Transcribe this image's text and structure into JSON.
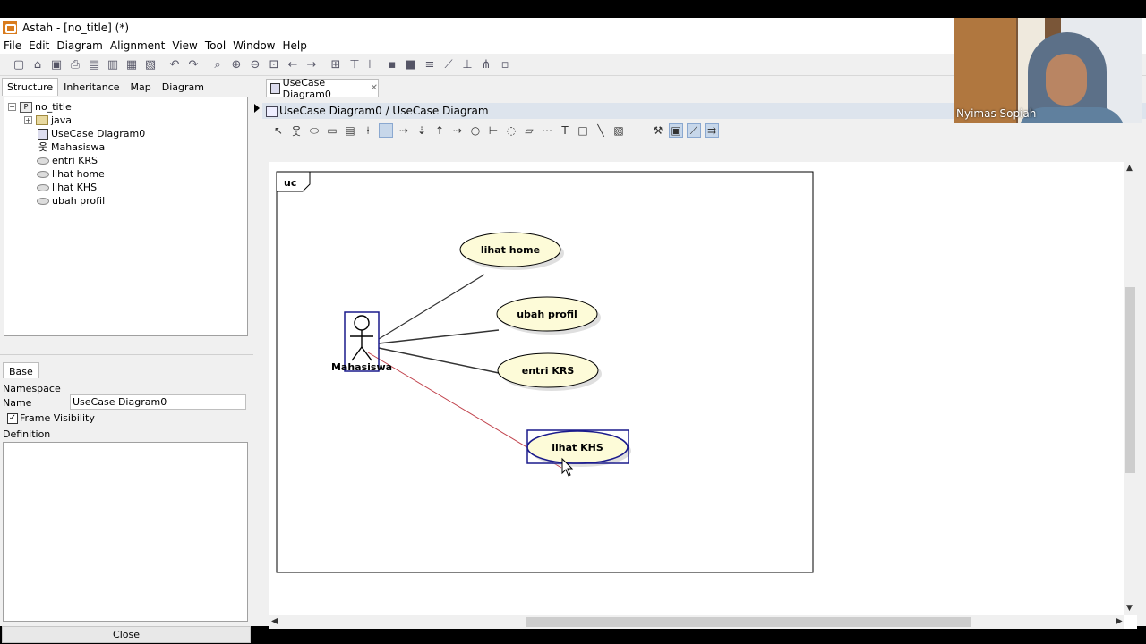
{
  "window": {
    "title": "Astah - [no_title] (*)"
  },
  "menu": [
    "File",
    "Edit",
    "Diagram",
    "Alignment",
    "View",
    "Tool",
    "Window",
    "Help"
  ],
  "left_tabs": [
    "Structure",
    "Inheritance",
    "Map",
    "Diagram"
  ],
  "tree": {
    "root": "no_title",
    "items": [
      {
        "label": "java",
        "icon": "folder-icon"
      },
      {
        "label": "UseCase Diagram0",
        "icon": "diagram-icon"
      },
      {
        "label": "Mahasiswa",
        "icon": "actor-icon"
      },
      {
        "label": "entri KRS",
        "icon": "usecase-icon"
      },
      {
        "label": "lihat home",
        "icon": "usecase-icon"
      },
      {
        "label": "lihat KHS",
        "icon": "usecase-icon"
      },
      {
        "label": "ubah profil",
        "icon": "usecase-icon"
      }
    ]
  },
  "properties": {
    "tab": "Base",
    "namespace_label": "Namespace",
    "name_label": "Name",
    "name_value": "UseCase Diagram0",
    "frame_visibility_label": "Frame Visibility",
    "frame_visibility_checked": true,
    "definition_label": "Definition",
    "close_label": "Close"
  },
  "editor": {
    "tab_label": "UseCase Diagram0",
    "header": "UseCase Diagram0 / UseCase Diagram"
  },
  "diagram": {
    "frame_label": "uc",
    "actor": "Mahasiswa",
    "usecases": [
      "lihat home",
      "ubah profil",
      "entri KRS",
      "lihat KHS"
    ],
    "selected_usecase": "lihat KHS",
    "colors": {
      "usecase_fill": "#fdfbd8",
      "selection": "#1a1a8c",
      "pending_link": "#c0404a"
    }
  },
  "webcam": {
    "name": "Nyimas Sopiah"
  }
}
